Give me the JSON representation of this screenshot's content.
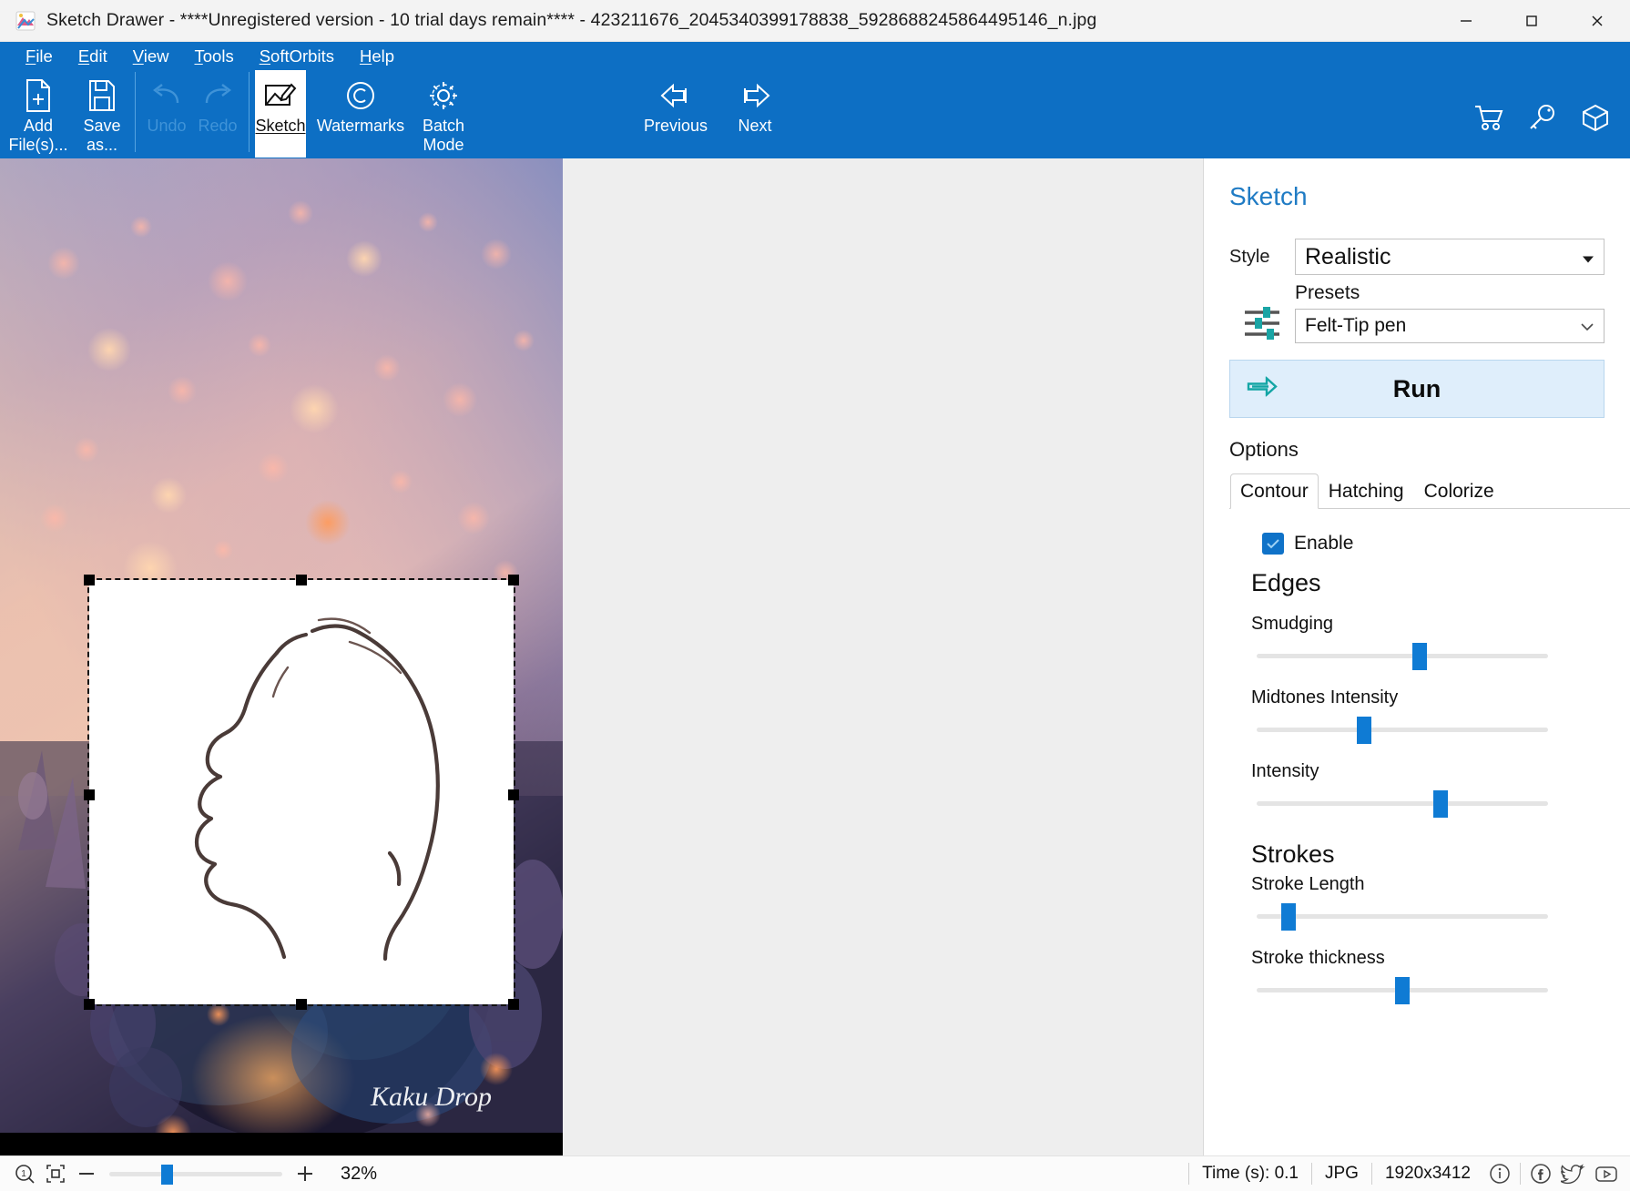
{
  "titlebar": {
    "app_icon": "sketch-drawer-app-icon",
    "title": "Sketch Drawer - ****Unregistered version - 10 trial days remain**** - 423211676_2045340399178838_5928688245864495146_n.jpg",
    "minimize": "—",
    "maximize": "□",
    "close": "✕"
  },
  "menubar": {
    "items": [
      {
        "pre": "",
        "key": "F",
        "post": "ile"
      },
      {
        "pre": "",
        "key": "E",
        "post": "dit"
      },
      {
        "pre": "",
        "key": "V",
        "post": "iew"
      },
      {
        "pre": "",
        "key": "T",
        "post": "ools"
      },
      {
        "pre": "",
        "key": "S",
        "post": "oftOrbits"
      },
      {
        "pre": "",
        "key": "H",
        "post": "elp"
      }
    ]
  },
  "ribbon": {
    "buttons": [
      {
        "label": "Add\nFile(s)...",
        "icon": "add-file-icon",
        "state": "enabled"
      },
      {
        "label": "Save\nas...",
        "icon": "save-disk-icon",
        "state": "enabled"
      },
      {
        "label": "Undo",
        "icon": "undo-arrow-icon",
        "state": "disabled"
      },
      {
        "label": "Redo",
        "icon": "redo-arrow-icon",
        "state": "disabled"
      },
      {
        "label": "Sketch",
        "icon": "sketch-pencil-icon",
        "state": "active"
      },
      {
        "label": "Watermarks",
        "icon": "copyright-icon",
        "state": "enabled"
      },
      {
        "label": "Batch\nMode",
        "icon": "gear-icon",
        "state": "enabled"
      },
      {
        "label": "Previous",
        "icon": "arrow-left-icon",
        "state": "enabled"
      },
      {
        "label": "Next",
        "icon": "arrow-right-icon",
        "state": "enabled"
      }
    ],
    "right_icons": [
      "cart-icon",
      "key-icon",
      "box-icon"
    ]
  },
  "canvas": {
    "watermark": "Kaku Drop",
    "selection": {
      "handles": 8
    }
  },
  "panel": {
    "title": "Sketch",
    "style_label": "Style",
    "style_value": "Realistic",
    "presets_label": "Presets",
    "presets_value": "Felt-Tip pen",
    "sliders_icon": "sliders-icon",
    "run_label": "Run",
    "run_icon": "run-arrow-icon",
    "options_label": "Options",
    "tabs": [
      {
        "label": "Contour",
        "selected": true
      },
      {
        "label": "Hatching",
        "selected": false
      },
      {
        "label": "Colorize",
        "selected": false
      }
    ],
    "enable_label": "Enable",
    "enable_checked": true,
    "groups": [
      {
        "title": "Edges",
        "sliders": [
          {
            "label": "Smudging",
            "percent": 56
          },
          {
            "label": "Midtones Intensity",
            "percent": 37
          },
          {
            "label": "Intensity",
            "percent": 63
          }
        ]
      },
      {
        "title": "Strokes",
        "sliders": [
          {
            "label": "Stroke Length",
            "percent": 11
          },
          {
            "label": "Stroke thickness",
            "percent": 50
          }
        ]
      }
    ]
  },
  "statusbar": {
    "zoom_icon": "zoom-one-to-one-icon",
    "fit_icon": "fit-to-window-icon",
    "minus": "−",
    "plus": "+",
    "zoom_percent": "32%",
    "time": "Time (s): 0.1",
    "format": "JPG",
    "dimensions": "1920x3412",
    "icons": [
      "info-icon",
      "facebook-icon",
      "twitter-icon",
      "youtube-icon"
    ]
  }
}
